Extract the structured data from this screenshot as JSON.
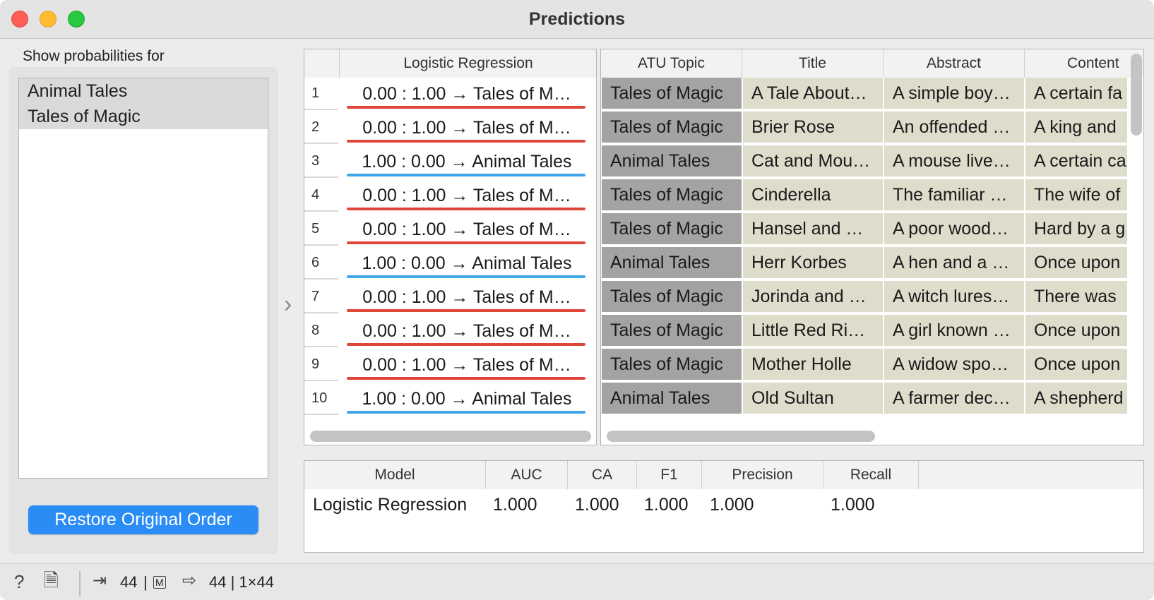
{
  "window": {
    "title": "Predictions"
  },
  "left_panel": {
    "label": "Show probabilities for",
    "classes": [
      "Animal Tales",
      "Tales of Magic"
    ],
    "restore_button": "Restore Original Order"
  },
  "predictions_table": {
    "header": "Logistic Regression",
    "rows": [
      {
        "n": "1",
        "text": "0.00 : 1.00 → Tales of M…",
        "cls": "magic"
      },
      {
        "n": "2",
        "text": "0.00 : 1.00 → Tales of M…",
        "cls": "magic"
      },
      {
        "n": "3",
        "text": "1.00 : 0.00 → Animal Tales",
        "cls": "animal"
      },
      {
        "n": "4",
        "text": "0.00 : 1.00 → Tales of M…",
        "cls": "magic"
      },
      {
        "n": "5",
        "text": "0.00 : 1.00 → Tales of M…",
        "cls": "magic"
      },
      {
        "n": "6",
        "text": "1.00 : 0.00 → Animal Tales",
        "cls": "animal"
      },
      {
        "n": "7",
        "text": "0.00 : 1.00 → Tales of M…",
        "cls": "magic"
      },
      {
        "n": "8",
        "text": "0.00 : 1.00 → Tales of M…",
        "cls": "magic"
      },
      {
        "n": "9",
        "text": "0.00 : 1.00 → Tales of M…",
        "cls": "magic"
      },
      {
        "n": "10",
        "text": "1.00 : 0.00 → Animal Tales",
        "cls": "animal"
      }
    ]
  },
  "data_table": {
    "headers": [
      "ATU Topic",
      "Title",
      "Abstract",
      "Content"
    ],
    "rows": [
      [
        "Tales of Magic",
        "A Tale About…",
        "A simple boy…",
        "A certain fa"
      ],
      [
        "Tales of Magic",
        "Brier Rose",
        "An offended …",
        "A king and"
      ],
      [
        "Animal Tales",
        "Cat and Mou…",
        "A mouse live…",
        "A certain ca"
      ],
      [
        "Tales of Magic",
        "Cinderella",
        "The familiar …",
        "The wife of"
      ],
      [
        "Tales of Magic",
        "Hansel and …",
        "A poor wood…",
        "Hard by a g"
      ],
      [
        "Animal Tales",
        "Herr Korbes",
        "A hen and a …",
        "Once upon"
      ],
      [
        "Tales of Magic",
        "Jorinda and …",
        "A witch lures…",
        "There was"
      ],
      [
        "Tales of Magic",
        "Little Red Ri…",
        "A girl known …",
        "Once upon"
      ],
      [
        "Tales of Magic",
        "Mother Holle",
        "A widow spo…",
        "Once upon"
      ],
      [
        "Animal Tales",
        "Old Sultan",
        "A farmer dec…",
        "A shepherd"
      ]
    ]
  },
  "evaluation": {
    "headers": [
      "Model",
      "AUC",
      "CA",
      "F1",
      "Precision",
      "Recall"
    ],
    "row": [
      "Logistic Regression",
      "1.000",
      "1.000",
      "1.000",
      "1.000",
      "1.000"
    ]
  },
  "statusbar": {
    "input_count": "44",
    "input_badge": "M",
    "output_text": "44 | 1×44"
  },
  "colors": {
    "magic_underline": "#e0473a",
    "animal_underline": "#3fa6e8",
    "accent_button": "#2a8cf5",
    "topic_cell": "#a3a3a3",
    "meta_cell": "#dedccb"
  }
}
